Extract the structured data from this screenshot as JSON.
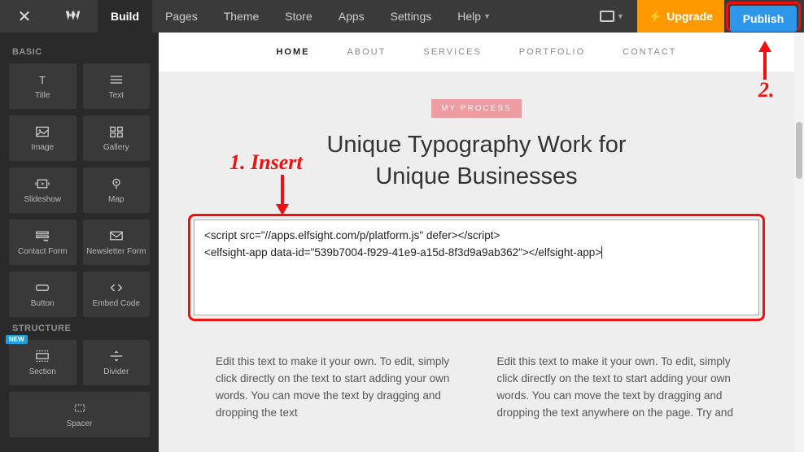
{
  "topnav": {
    "items": [
      "Build",
      "Pages",
      "Theme",
      "Store",
      "Apps",
      "Settings",
      "Help"
    ],
    "active_index": 0,
    "upgrade_label": "Upgrade",
    "publish_label": "Publish"
  },
  "sidebar": {
    "sections": [
      {
        "title": "BASIC",
        "tiles": [
          {
            "label": "Title",
            "icon": "title-icon"
          },
          {
            "label": "Text",
            "icon": "text-icon"
          },
          {
            "label": "Image",
            "icon": "image-icon"
          },
          {
            "label": "Gallery",
            "icon": "gallery-icon"
          },
          {
            "label": "Slideshow",
            "icon": "slideshow-icon"
          },
          {
            "label": "Map",
            "icon": "map-icon"
          },
          {
            "label": "Contact Form",
            "icon": "contact-form-icon"
          },
          {
            "label": "Newsletter Form",
            "icon": "newsletter-icon"
          },
          {
            "label": "Button",
            "icon": "button-icon"
          },
          {
            "label": "Embed Code",
            "icon": "embed-icon"
          }
        ]
      },
      {
        "title": "STRUCTURE",
        "tiles": [
          {
            "label": "Section",
            "icon": "section-icon",
            "badge": "NEW"
          },
          {
            "label": "Divider",
            "icon": "divider-icon"
          },
          {
            "label": "Spacer",
            "icon": "spacer-icon",
            "full": true
          }
        ]
      }
    ]
  },
  "site_nav": {
    "items": [
      "HOME",
      "ABOUT",
      "SERVICES",
      "PORTFOLIO",
      "CONTACT"
    ],
    "active_index": 0
  },
  "hero": {
    "badge": "MY PROCESS",
    "title_line1": "Unique Typography Work for",
    "title_line2": "Unique Businesses"
  },
  "embed": {
    "code": "<script src=\"//apps.elfsight.com/p/platform.js\" defer></script>\n<elfsight-app data-id=\"539b7004-f929-41e9-a15d-8f3d9a9ab362\"></elfsight-app>"
  },
  "columns": {
    "left": "Edit this text to make it your own. To edit, simply click directly on the text to start adding your own words. You can move the text by dragging and dropping the text",
    "right": "Edit this text to make it your own. To edit, simply click directly on the text to start adding your own words. You can move the text by dragging and dropping the text anywhere on the page. Try and"
  },
  "annotations": {
    "insert": "1. Insert",
    "two": "2."
  },
  "colors": {
    "accent_orange": "#ff9900",
    "accent_blue": "#2f97ea",
    "annotation_red": "#e11"
  }
}
